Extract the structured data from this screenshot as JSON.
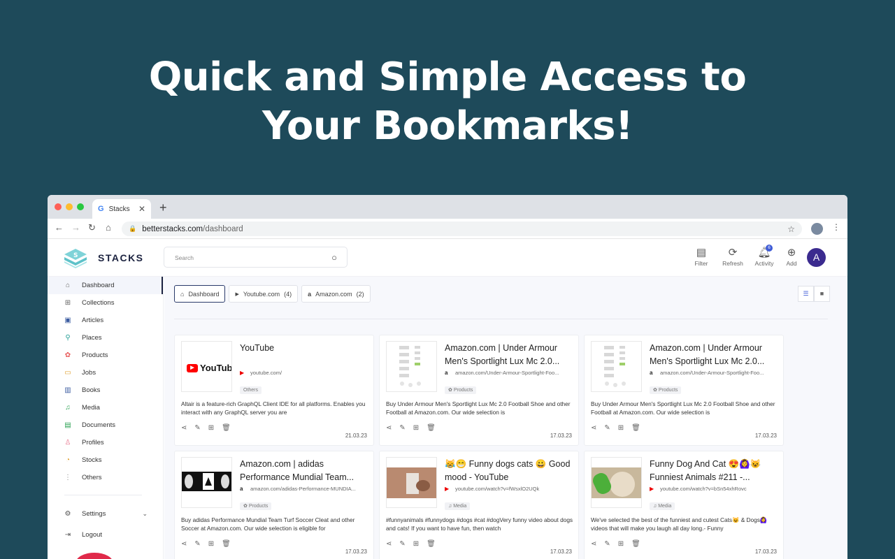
{
  "headline": {
    "line1": "Quick and Simple Access to",
    "line2": "Your Bookmarks!"
  },
  "browser": {
    "tab_title": "Stacks",
    "url_domain": "betterstacks.com",
    "url_path": "/dashboard"
  },
  "app": {
    "logo_text": "STACKS",
    "search_placeholder": "Search",
    "header_buttons": [
      {
        "label": "Filter",
        "icon": "filter-icon"
      },
      {
        "label": "Refresh",
        "icon": "refresh-icon"
      },
      {
        "label": "Activity",
        "icon": "bell-icon",
        "badge": "6"
      },
      {
        "label": "Add",
        "icon": "plus-circle-icon"
      }
    ],
    "avatar_letter": "A"
  },
  "sidebar": {
    "items": [
      {
        "label": "Dashboard",
        "icon": "home-icon",
        "color": "#666666"
      },
      {
        "label": "Collections",
        "icon": "grid-icon",
        "color": "#666666"
      },
      {
        "label": "Articles",
        "icon": "newspaper-icon",
        "color": "#3a5ba0"
      },
      {
        "label": "Places",
        "icon": "map-pin-icon",
        "color": "#2aa198"
      },
      {
        "label": "Products",
        "icon": "tag-icon",
        "color": "#e85a5a"
      },
      {
        "label": "Jobs",
        "icon": "briefcase-icon",
        "color": "#e0a030"
      },
      {
        "label": "Books",
        "icon": "book-icon",
        "color": "#3a5ba0"
      },
      {
        "label": "Media",
        "icon": "music-icon",
        "color": "#2aa152"
      },
      {
        "label": "Documents",
        "icon": "document-icon",
        "color": "#2aa152"
      },
      {
        "label": "Profiles",
        "icon": "user-icon",
        "color": "#e8708a"
      },
      {
        "label": "Stocks",
        "icon": "stocks-icon",
        "color": "#e0a030"
      },
      {
        "label": "Others",
        "icon": "more-vertical-icon",
        "color": "#888888"
      }
    ],
    "settings_label": "Settings",
    "logout_label": "Logout"
  },
  "chips": [
    {
      "label": "Dashboard",
      "count": ""
    },
    {
      "label": "Youtube.com",
      "count": "(4)"
    },
    {
      "label": "Amazon.com",
      "count": "(2)"
    }
  ],
  "cards": [
    {
      "title": "YouTube",
      "url": "youtube.com/",
      "site": "youtube",
      "tag": "Others",
      "desc": "Altair is a feature-rich GraphQL Client IDE for all platforms. Enables you interact with any GraphQL server you are",
      "date": "21.03.23",
      "thumb": "youtube-logo"
    },
    {
      "title": "Amazon.com | Under Armour Men's Sportlight Lux Mc 2.0...",
      "url": "amazon.com/Under-Armour-Sportlight-Foo...",
      "site": "amazon",
      "tag": "Products",
      "desc": "Buy Under Armour Men's Sportlight Lux Mc 2.0 Football Shoe and other Football at Amazon.com. Our wide selection is",
      "date": "17.03.23",
      "thumb": "shoes"
    },
    {
      "title": "Amazon.com | Under Armour Men's Sportlight Lux Mc 2.0...",
      "url": "amazon.com/Under-Armour-Sportlight-Foo...",
      "site": "amazon",
      "tag": "Products",
      "desc": "Buy Under Armour Men's Sportlight Lux Mc 2.0 Football Shoe and other Football at Amazon.com. Our wide selection is",
      "date": "17.03.23",
      "thumb": "shoes"
    },
    {
      "title": "Amazon.com | adidas Performance Mundial Team...",
      "url": "amazon.com/adidas-Performance-MUNDIA...",
      "site": "amazon",
      "tag": "Products",
      "desc": "Buy adidas Performance Mundial Team Turf Soccer Cleat and other Soccer at Amazon.com. Our wide selection is eligible for",
      "date": "17.03.23",
      "thumb": "adidas"
    },
    {
      "title": "😹😁 Funny dogs cats 😀 Good mood - YouTube",
      "url": "youtube.com/watch?v=fWsxlO2UQk",
      "site": "youtube",
      "tag": "Media",
      "desc": "#funnyanimals #funnydogs #dogs #cat #dogVery funny video about dogs and cats! If you want to have fun, then watch",
      "date": "17.03.23",
      "thumb": "dog"
    },
    {
      "title": "Funny Dog And Cat 😍🙆‍♀️😺 Funniest Animals #211 -...",
      "url": "youtube.com/watch?v=bSn54xhRovc",
      "site": "youtube",
      "tag": "Media",
      "desc": "We've selected the best of the funniest and cutest Cats😺 & Dogs🙆‍♀️ videos that will make you laugh all day long.- Funny",
      "date": "17.03.23",
      "thumb": "cat"
    }
  ],
  "colors": {
    "background": "#1e4a5a",
    "accent": "#3e5bd6",
    "avatar": "#3b2b8f"
  }
}
